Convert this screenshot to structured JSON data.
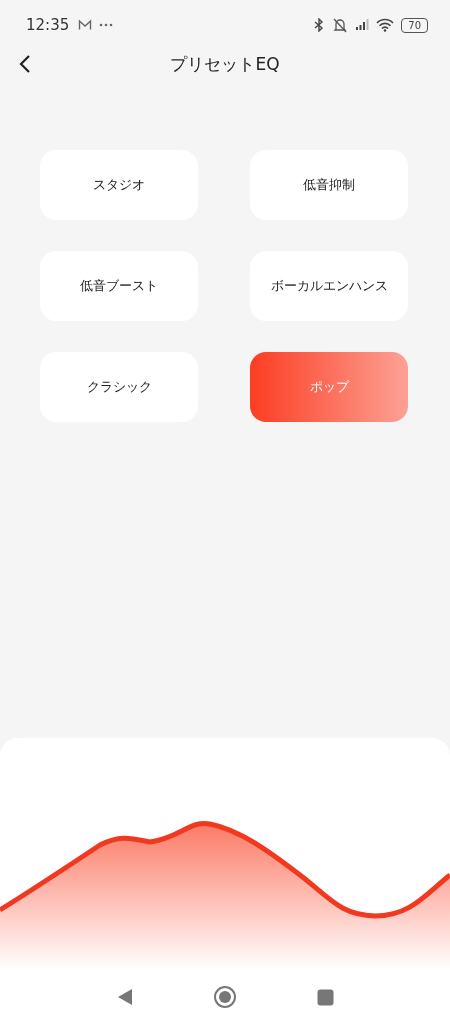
{
  "status_bar": {
    "time": "12:35",
    "battery": "70"
  },
  "header": {
    "title": "プリセットEQ"
  },
  "presets": [
    {
      "label": "スタジオ",
      "selected": false
    },
    {
      "label": "低音抑制",
      "selected": false
    },
    {
      "label": "低音ブースト",
      "selected": false
    },
    {
      "label": "ボーカルエンハンス",
      "selected": false
    },
    {
      "label": "クラシック",
      "selected": false
    },
    {
      "label": "ポップ",
      "selected": true
    }
  ]
}
